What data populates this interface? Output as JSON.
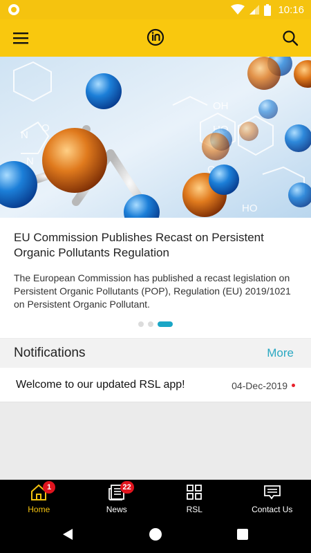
{
  "status_bar": {
    "time": "10:16",
    "icons": [
      "wifi-icon",
      "signal-icon",
      "battery-icon"
    ]
  },
  "app_bar": {
    "menu_icon": "hamburger-icon",
    "logo_icon": "intertek-logo",
    "search_icon": "search-icon"
  },
  "hero": {
    "image_description": "molecule-illustration",
    "headline": "EU Commission Publishes Recast on Persistent Organic Pollutants Regulation",
    "summary": "The European Commission has published a recast legislation on Persistent Organic Pollutants (POP), Regulation (EU) 2019/1021 on Persistent Organic Pollutant.",
    "carousel": {
      "total": 3,
      "active_index": 2
    }
  },
  "notifications": {
    "title": "Notifications",
    "more_label": "More",
    "items": [
      {
        "message": "Welcome to our updated RSL app!",
        "date": "04-Dec-2019",
        "unread": true
      }
    ]
  },
  "bottom_nav": {
    "items": [
      {
        "label": "Home",
        "icon": "home-icon",
        "badge": "1",
        "active": true
      },
      {
        "label": "News",
        "icon": "news-icon",
        "badge": "22",
        "active": false
      },
      {
        "label": "RSL",
        "icon": "grid-icon",
        "badge": "",
        "active": false
      },
      {
        "label": "Contact Us",
        "icon": "chat-icon",
        "badge": "",
        "active": false
      }
    ]
  },
  "colors": {
    "brand_yellow": "#f9c80e",
    "accent_teal": "#2aa8c2",
    "badge_red": "#e0141e"
  }
}
